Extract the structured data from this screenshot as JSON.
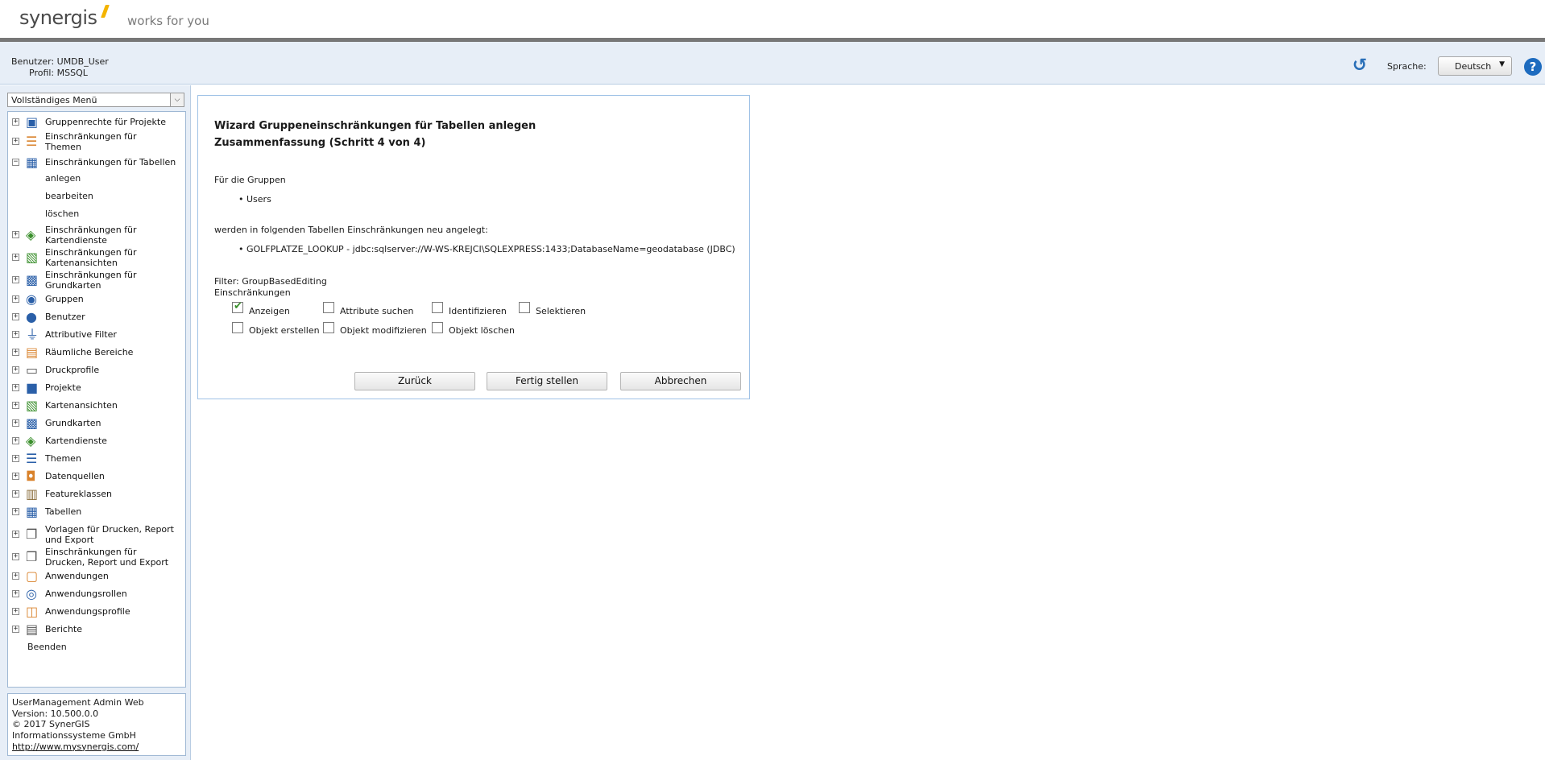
{
  "header": {
    "logo": "synergis",
    "tagline": "works for you"
  },
  "userbar": {
    "user_label": "Benutzer: UMDB_User",
    "profile_label": "Profil: MSSQL",
    "language_label": "Sprache:",
    "language_value": "Deutsch"
  },
  "sidebar": {
    "menu_select": "Vollständiges Menü",
    "tree": [
      {
        "label": "Gruppenrechte für Projekte",
        "icon": "group-rights-icon"
      },
      {
        "label": "Einschränkungen für Themen",
        "icon": "theme-restrictions-icon"
      },
      {
        "label": "Einschränkungen für Tabellen",
        "icon": "table-restrictions-icon",
        "expanded": true,
        "children": [
          "anlegen",
          "bearbeiten",
          "löschen"
        ]
      },
      {
        "label": "Einschränkungen für Kartendienste",
        "icon": "mapservice-restrictions-icon"
      },
      {
        "label": "Einschränkungen für Kartenansichten",
        "icon": "mapview-restrictions-icon"
      },
      {
        "label": "Einschränkungen für Grundkarten",
        "icon": "basemap-restrictions-icon"
      },
      {
        "label": "Gruppen",
        "icon": "groups-icon"
      },
      {
        "label": "Benutzer",
        "icon": "user-icon"
      },
      {
        "label": "Attributive Filter",
        "icon": "filter-icon"
      },
      {
        "label": "Räumliche Bereiche",
        "icon": "spatial-area-icon"
      },
      {
        "label": "Druckprofile",
        "icon": "printer-icon"
      },
      {
        "label": "Projekte",
        "icon": "project-icon"
      },
      {
        "label": "Kartenansichten",
        "icon": "mapview-icon"
      },
      {
        "label": "Grundkarten",
        "icon": "basemap-icon"
      },
      {
        "label": "Kartendienste",
        "icon": "mapservice-icon"
      },
      {
        "label": "Themen",
        "icon": "themes-icon"
      },
      {
        "label": "Datenquellen",
        "icon": "datasource-icon"
      },
      {
        "label": "Featureklassen",
        "icon": "featureclass-icon"
      },
      {
        "label": "Tabellen",
        "icon": "table-icon"
      },
      {
        "label": "Vorlagen für Drucken, Report und Export",
        "icon": "templates-icon"
      },
      {
        "label": "Einschränkungen für Drucken, Report und Export",
        "icon": "print-restrictions-icon"
      },
      {
        "label": "Anwendungen",
        "icon": "applications-icon"
      },
      {
        "label": "Anwendungsrollen",
        "icon": "application-roles-icon"
      },
      {
        "label": "Anwendungsprofile",
        "icon": "application-profiles-icon"
      },
      {
        "label": "Berichte",
        "icon": "reports-icon"
      }
    ],
    "quit": "Beenden",
    "info": {
      "app": "UserManagement Admin Web",
      "version": "Version: 10.500.0.0",
      "copyright": "© 2017 SynerGIS Informationssysteme GmbH",
      "link": "http://www.mysynergis.com/"
    }
  },
  "wizard": {
    "title_line1": "Wizard Gruppeneinschränkungen für Tabellen anlegen",
    "title_line2": "Zusammenfassung (Schritt 4 von 4)",
    "groups_intro": "Für die Gruppen",
    "groups": [
      "Users"
    ],
    "tables_intro": "werden in folgenden Tabellen Einschränkungen neu angelegt:",
    "tables": [
      "GOLFPLATZE_LOOKUP - jdbc:sqlserver://W-WS-KREJCI\\SQLEXPRESS:1433;DatabaseName=geodatabase (JDBC)"
    ],
    "filter": "Filter: GroupBasedEditing",
    "restrictions_label": "Einschränkungen",
    "checkboxes": [
      {
        "label": "Anzeigen",
        "checked": true
      },
      {
        "label": "Attribute suchen",
        "checked": false
      },
      {
        "label": "Identifizieren",
        "checked": false
      },
      {
        "label": "Selektieren",
        "checked": false
      },
      {
        "label": "Objekt erstellen",
        "checked": false
      },
      {
        "label": "Objekt modifizieren",
        "checked": false
      },
      {
        "label": "Objekt löschen",
        "checked": false
      }
    ],
    "buttons": {
      "back": "Zurück",
      "finish": "Fertig stellen",
      "cancel": "Abbrechen"
    }
  },
  "colors": {
    "panel_bg": "#e7eef7",
    "accent": "#1d6bbf",
    "logo_accent": "#f4b400",
    "check": "#3a8f2c"
  }
}
